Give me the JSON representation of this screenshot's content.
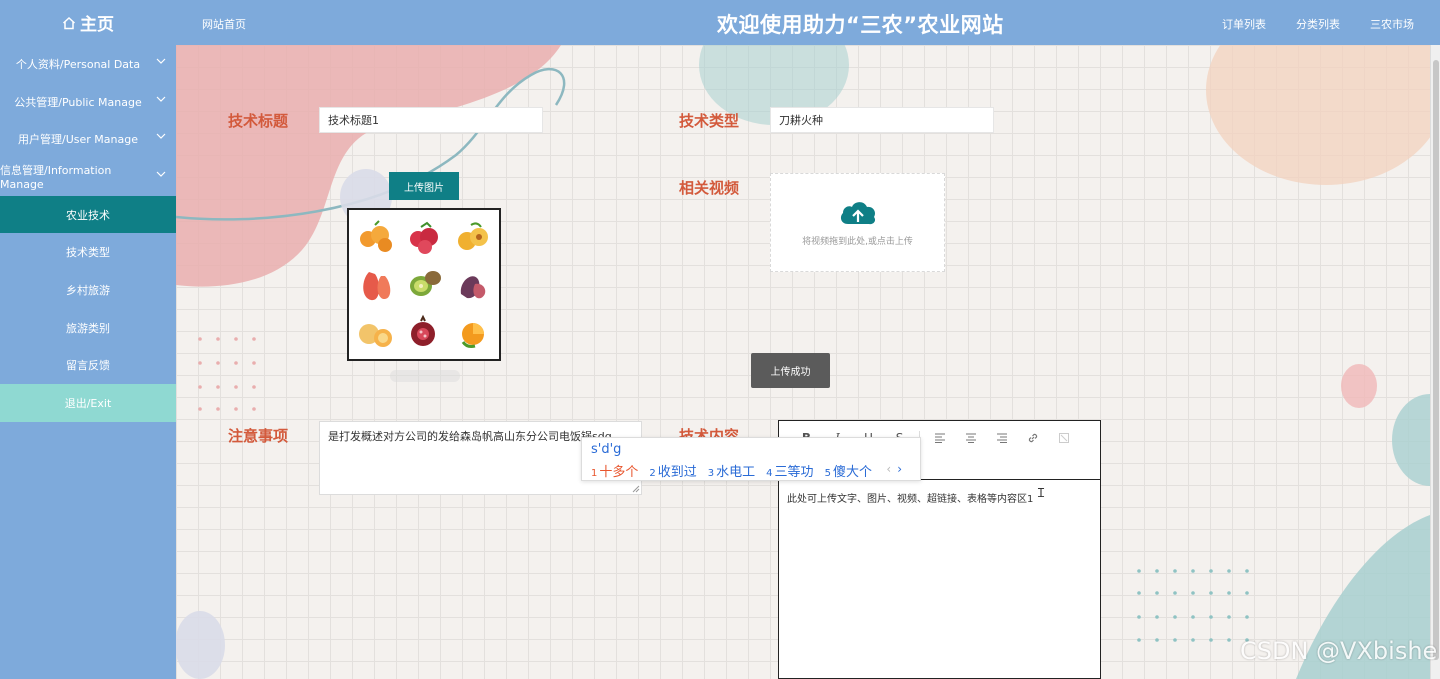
{
  "header": {
    "home_label": "主页",
    "site_home": "网站首页",
    "title": "欢迎使用助力“三农”农业网站",
    "links": [
      "订单列表",
      "分类列表",
      "三农市场"
    ]
  },
  "sidebar": {
    "items": [
      {
        "label": "个人资料/Personal Data",
        "type": "parent"
      },
      {
        "label": "公共管理/Public Manage",
        "type": "parent"
      },
      {
        "label": "用户管理/User Manage",
        "type": "parent"
      },
      {
        "label": "信息管理/Information Manage",
        "type": "parent"
      },
      {
        "label": "农业技术",
        "type": "active"
      },
      {
        "label": "技术类型",
        "type": "child"
      },
      {
        "label": "乡村旅游",
        "type": "child"
      },
      {
        "label": "旅游类别",
        "type": "child"
      },
      {
        "label": "留言反馈",
        "type": "child"
      },
      {
        "label": "退出/Exit",
        "type": "exit"
      }
    ]
  },
  "form": {
    "title_label": "技术标题",
    "title_value": "技术标题1",
    "type_label": "技术类型",
    "type_value": "刀耕火种",
    "upload_image_button": "上传图片",
    "video_label": "相关视频",
    "video_upload_text": "将视频拖到此处,或点击上传",
    "notes_label": "注意事项",
    "notes_value": "是打发概述对方公司的发给森岛帆高山东分公司电饭锅sdg",
    "content_label": "技术内容",
    "content_value": "此处可上传文字、图片、视频、超链接、表格等内容区1"
  },
  "toast": "上传成功",
  "ime": {
    "input": "s'd'g",
    "candidates": [
      {
        "num": "1",
        "text": "十多个"
      },
      {
        "num": "2",
        "text": "收到过"
      },
      {
        "num": "3",
        "text": "水电工"
      },
      {
        "num": "4",
        "text": "三等功"
      },
      {
        "num": "5",
        "text": "傻大个"
      }
    ],
    "prev": "‹",
    "next": "›"
  },
  "editor_toolbar": [
    "B",
    "I",
    "U",
    "S"
  ],
  "watermark": "CSDN @VXbishe",
  "colors": {
    "header_bg": "#7eaadb",
    "active_menu": "#0f7f86",
    "exit_menu": "#8fd9d2",
    "label": "#d35a3c",
    "ime_text": "#2a6bd6",
    "ime_first": "#e8562e"
  }
}
